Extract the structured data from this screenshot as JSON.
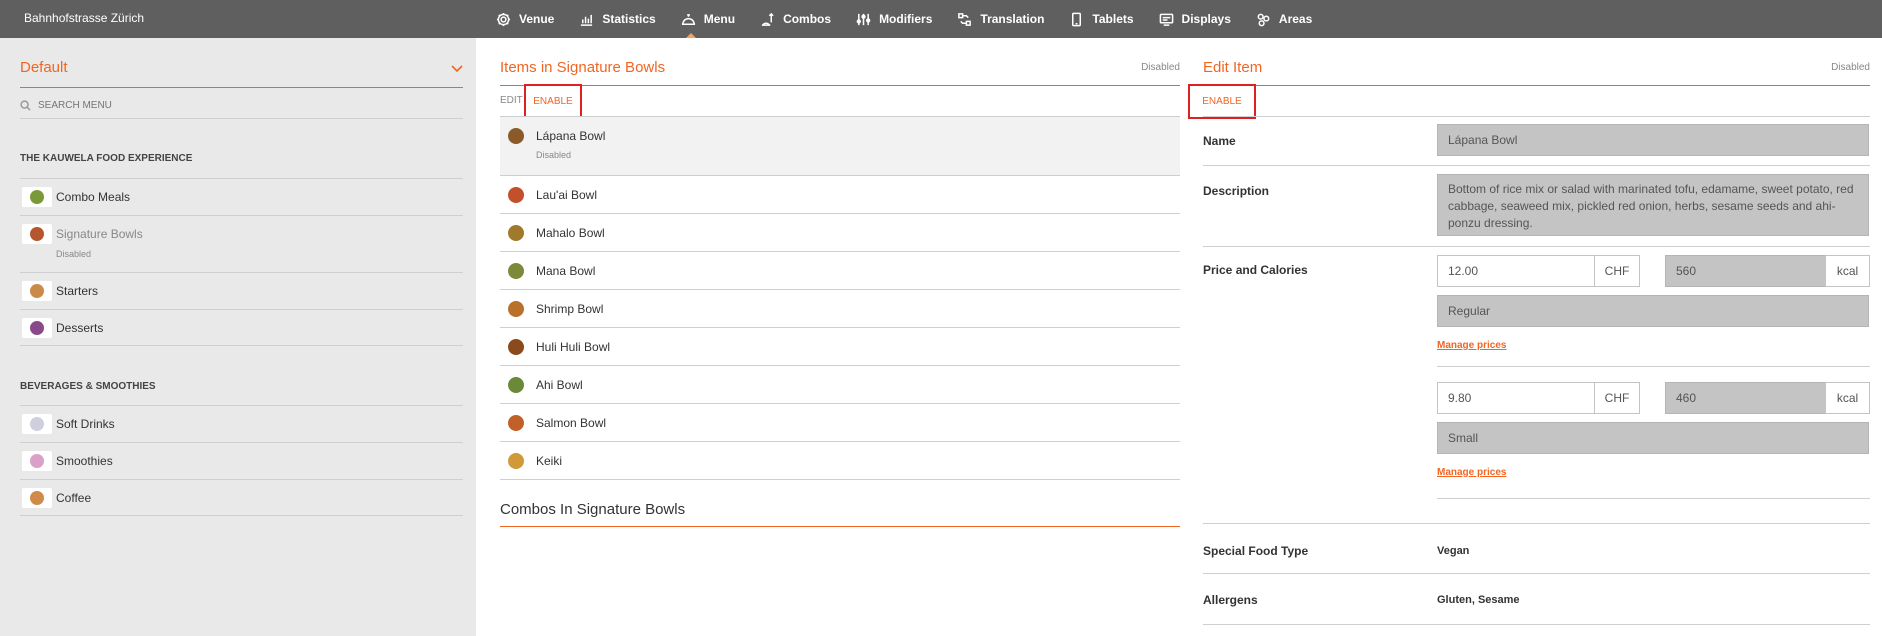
{
  "header": {
    "venue_name": "Bahnhofstrasse Zürich",
    "nav": [
      {
        "label": "Venue",
        "icon": "gear-icon"
      },
      {
        "label": "Statistics",
        "icon": "chart-icon"
      },
      {
        "label": "Menu",
        "icon": "cloche-icon",
        "active": true
      },
      {
        "label": "Combos",
        "icon": "combo-icon"
      },
      {
        "label": "Modifiers",
        "icon": "sliders-icon"
      },
      {
        "label": "Translation",
        "icon": "translate-icon"
      },
      {
        "label": "Tablets",
        "icon": "tablet-icon"
      },
      {
        "label": "Displays",
        "icon": "display-icon"
      },
      {
        "label": "Areas",
        "icon": "areas-icon"
      }
    ]
  },
  "sidebar": {
    "menu_select": "Default",
    "search_placeholder": "SEARCH MENU",
    "sections": [
      {
        "title": "THE KAUWELA FOOD EXPERIENCE",
        "items": [
          {
            "label": "Combo Meals",
            "color": "#7a9a3a"
          },
          {
            "label": "Signature Bowls",
            "sub": "Disabled",
            "color": "#b5562c"
          },
          {
            "label": "Starters",
            "color": "#c98a4a"
          },
          {
            "label": "Desserts",
            "color": "#8a4a8a"
          }
        ]
      },
      {
        "title": "BEVERAGES & SMOOTHIES",
        "items": [
          {
            "label": "Soft Drinks",
            "color": "#cfcfe0"
          },
          {
            "label": "Smoothies",
            "color": "#d9a0c8"
          },
          {
            "label": "Coffee",
            "color": "#d08a4a"
          }
        ]
      }
    ]
  },
  "items_panel": {
    "title": "Items in Signature Bowls",
    "status": "Disabled",
    "edit_label": "EDIT",
    "enable_label": "ENABLE",
    "items": [
      {
        "label": "Lápana Bowl",
        "sub": "Disabled",
        "color": "#8a5a2a"
      },
      {
        "label": "Lau'ai Bowl",
        "color": "#c2502a"
      },
      {
        "label": "Mahalo Bowl",
        "color": "#a07a2a"
      },
      {
        "label": "Mana Bowl",
        "color": "#7a8a3a"
      },
      {
        "label": "Shrimp Bowl",
        "color": "#b8702a"
      },
      {
        "label": "Huli Huli Bowl",
        "color": "#8a4a1a"
      },
      {
        "label": "Ahi Bowl",
        "color": "#6a8a3a"
      },
      {
        "label": "Salmon Bowl",
        "color": "#c2602a"
      },
      {
        "label": "Keiki",
        "color": "#d09a3a"
      }
    ],
    "combos_title": "Combos In Signature Bowls"
  },
  "edit_panel": {
    "title": "Edit Item",
    "status": "Disabled",
    "enable_label": "ENABLE",
    "name_label": "Name",
    "name_value": "Lápana Bowl",
    "description_label": "Description",
    "description_value": "Bottom of rice mix or salad with marinated tofu, edamame, sweet potato, red cabbage, seaweed mix, pickled red onion, herbs, sesame seeds and ahi-ponzu dressing.",
    "price_label": "Price and Calories",
    "prices": [
      {
        "price": "12.00",
        "currency": "CHF",
        "calories": "560",
        "unit": "kcal",
        "size": "Regular",
        "manage": "Manage prices"
      },
      {
        "price": "9.80",
        "currency": "CHF",
        "calories": "460",
        "unit": "kcal",
        "size": "Small",
        "manage": "Manage prices"
      }
    ],
    "food_type_label": "Special Food Type",
    "food_type_value": "Vegan",
    "allergens_label": "Allergens",
    "allergens_value": "Gluten, Sesame"
  },
  "colors": {
    "accent": "#f26522",
    "topbar": "#5f5f5f",
    "sidebar": "#e9e9e9",
    "highlight_box": "#e02020"
  }
}
